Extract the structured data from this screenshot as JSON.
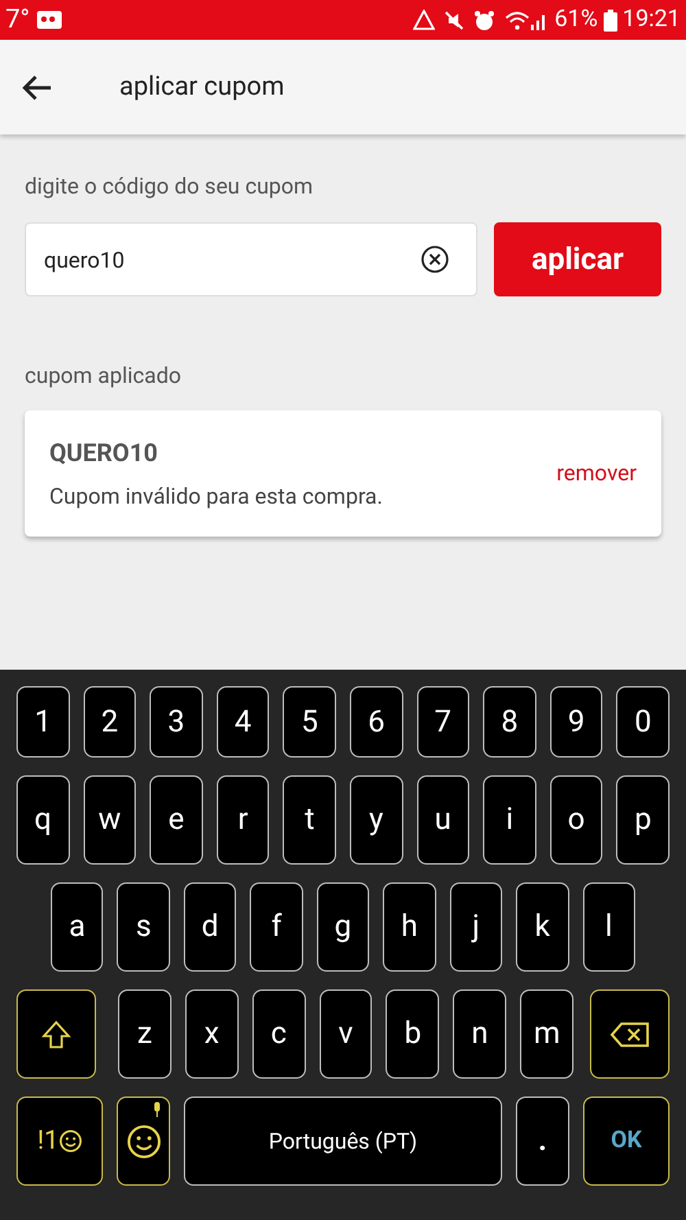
{
  "status_bar": {
    "temperature": "7°",
    "battery": "61%",
    "time": "19:21"
  },
  "header": {
    "title": "aplicar cupom"
  },
  "coupon_form": {
    "label": "digite o código do seu cupom",
    "value": "quero10",
    "apply_button": "aplicar"
  },
  "applied_coupon": {
    "section_label": "cupom aplicado",
    "code": "QUERO10",
    "message": "Cupom inválido para esta compra.",
    "remove_link": "remover"
  },
  "keyboard": {
    "number_row": [
      "1",
      "2",
      "3",
      "4",
      "5",
      "6",
      "7",
      "8",
      "9",
      "0"
    ],
    "letter_rows": [
      [
        "q",
        "w",
        "e",
        "r",
        "t",
        "y",
        "u",
        "i",
        "o",
        "p"
      ],
      [
        "a",
        "s",
        "d",
        "f",
        "g",
        "h",
        "j",
        "k",
        "l"
      ],
      [
        "z",
        "x",
        "c",
        "v",
        "b",
        "n",
        "m"
      ]
    ],
    "symbols_key": "!1",
    "space_key": "Português (PT)",
    "period_key": ".",
    "ok_key": "OK"
  }
}
